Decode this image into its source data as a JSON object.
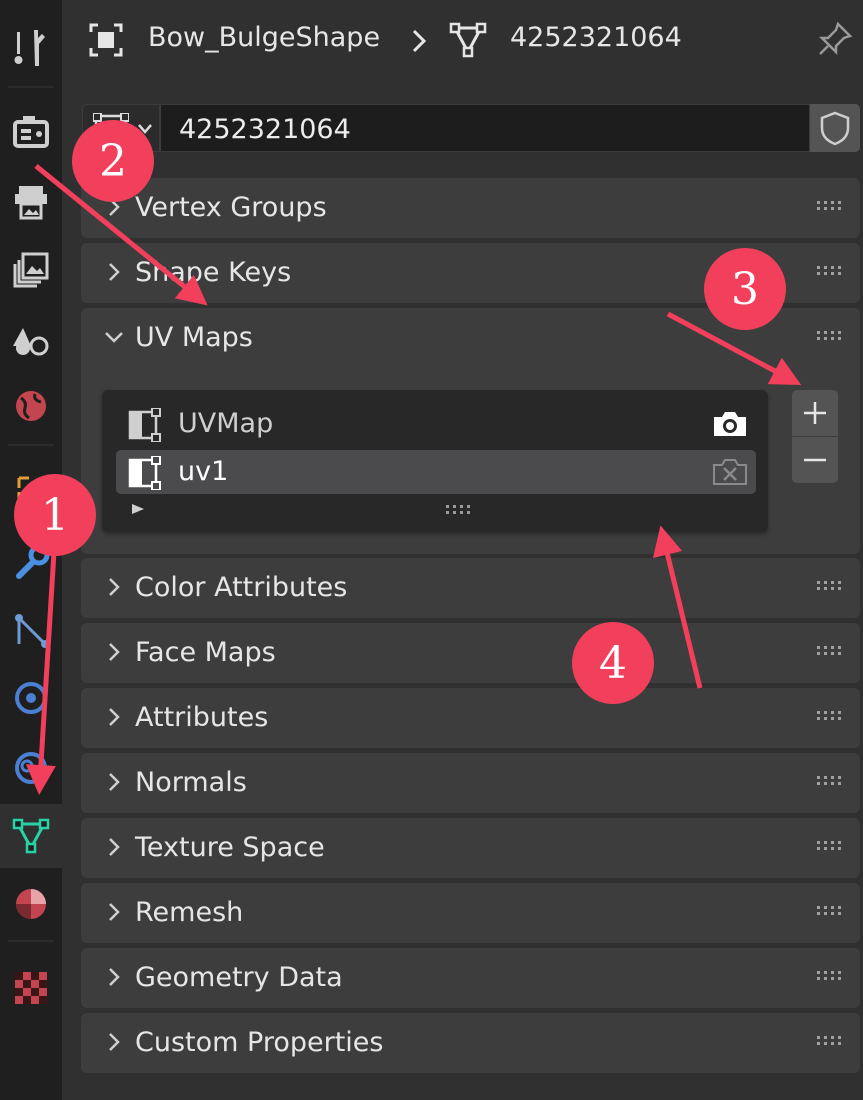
{
  "header": {
    "object_name": "Bow_BulgeShape",
    "separator": "›",
    "mesh_name": "4252321064"
  },
  "mesh_selector": {
    "name_value": "4252321064"
  },
  "panels": [
    {
      "title": "Vertex Groups",
      "expanded": false
    },
    {
      "title": "Shape Keys",
      "expanded": false
    },
    {
      "title": "UV Maps",
      "expanded": true
    },
    {
      "title": "Color Attributes",
      "expanded": false
    },
    {
      "title": "Face Maps",
      "expanded": false
    },
    {
      "title": "Attributes",
      "expanded": false
    },
    {
      "title": "Normals",
      "expanded": false
    },
    {
      "title": "Texture Space",
      "expanded": false
    },
    {
      "title": "Remesh",
      "expanded": false
    },
    {
      "title": "Geometry Data",
      "expanded": false
    },
    {
      "title": "Custom Properties",
      "expanded": false
    }
  ],
  "uv_maps": [
    {
      "name": "UVMap",
      "active_render": true,
      "selected": false
    },
    {
      "name": "uv1",
      "active_render": false,
      "selected": true
    }
  ],
  "annotations": [
    "1",
    "2",
    "3",
    "4"
  ],
  "colors": {
    "annotation": "#f2405c",
    "active_tab_icon": "#27d3a5",
    "background": "#303030"
  },
  "tabs": [
    "tool-icon",
    "render-icon",
    "output-icon",
    "view-layer-icon",
    "scene-icon",
    "world-icon",
    "object-icon",
    "modifier-icon",
    "particles-icon",
    "physics-icon",
    "constraints-icon",
    "mesh-data-icon",
    "material-icon",
    "texture-icon"
  ]
}
